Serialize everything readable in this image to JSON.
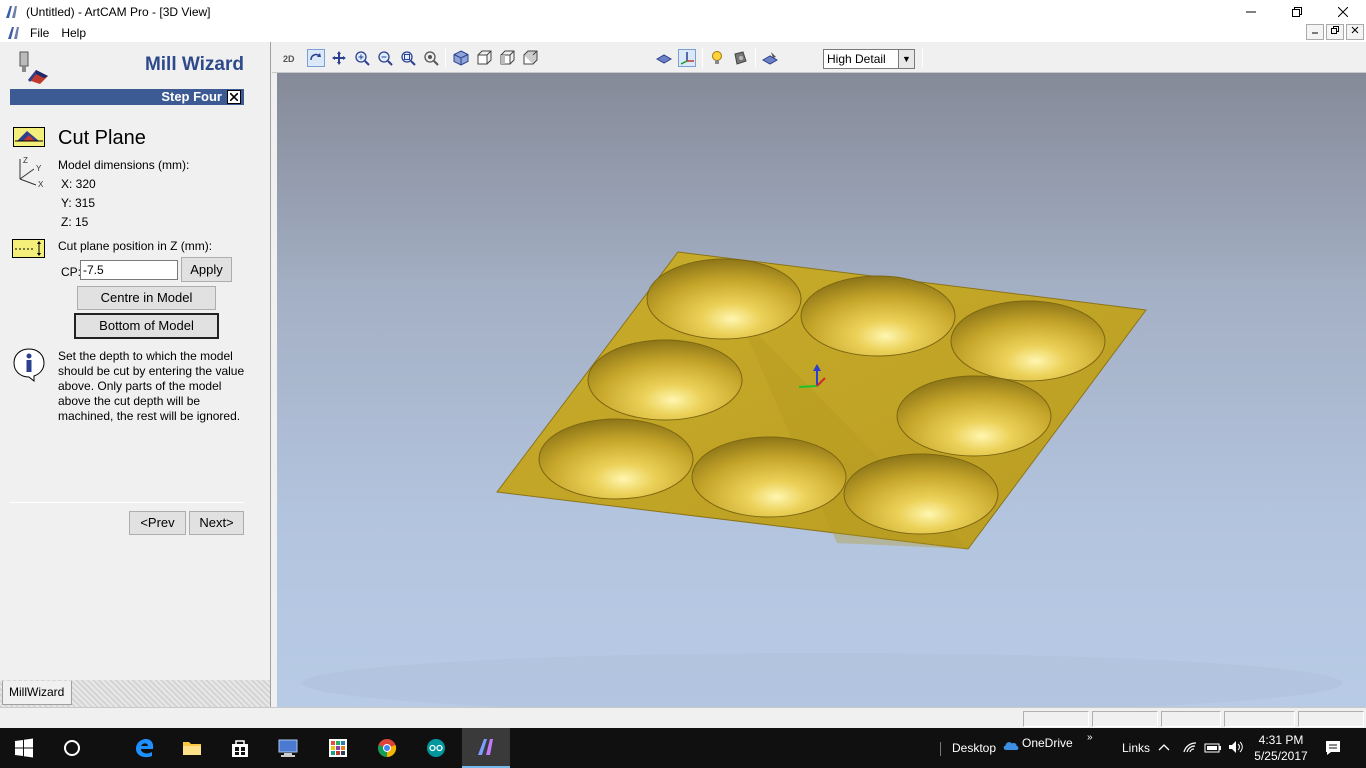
{
  "window": {
    "title": "(Untitled) - ArtCAM Pro - [3D View]"
  },
  "menu": {
    "file": "File",
    "help": "Help"
  },
  "wizard": {
    "title": "Mill Wizard",
    "step": "Step Four",
    "heading": "Cut Plane",
    "dims_label": "Model dimensions (mm):",
    "dim_x": "X: 320",
    "dim_y": "Y: 315",
    "dim_z": "Z: 15",
    "cp_label": "Cut plane position in Z (mm):",
    "cp_prefix": "CP:",
    "cp_value": "-7.5",
    "apply": "Apply",
    "centre": "Centre in Model",
    "bottom": "Bottom of Model",
    "info": "Set the depth to which the model should be cut by entering the value above. Only parts of the model above the cut depth will be machined, the rest will be ignored.",
    "prev": "<Prev",
    "next": "Next>",
    "tab": "MillWizard"
  },
  "toolbar": {
    "detail": "High Detail"
  },
  "taskbar": {
    "desktop": "Desktop",
    "onedrive": "OneDrive",
    "links": "Links",
    "time": "4:31 PM",
    "date": "5/25/2017"
  },
  "colors": {
    "model": "#c9ac2a",
    "accent": "#3c5a93",
    "title_blue": "#2f4a8a"
  }
}
